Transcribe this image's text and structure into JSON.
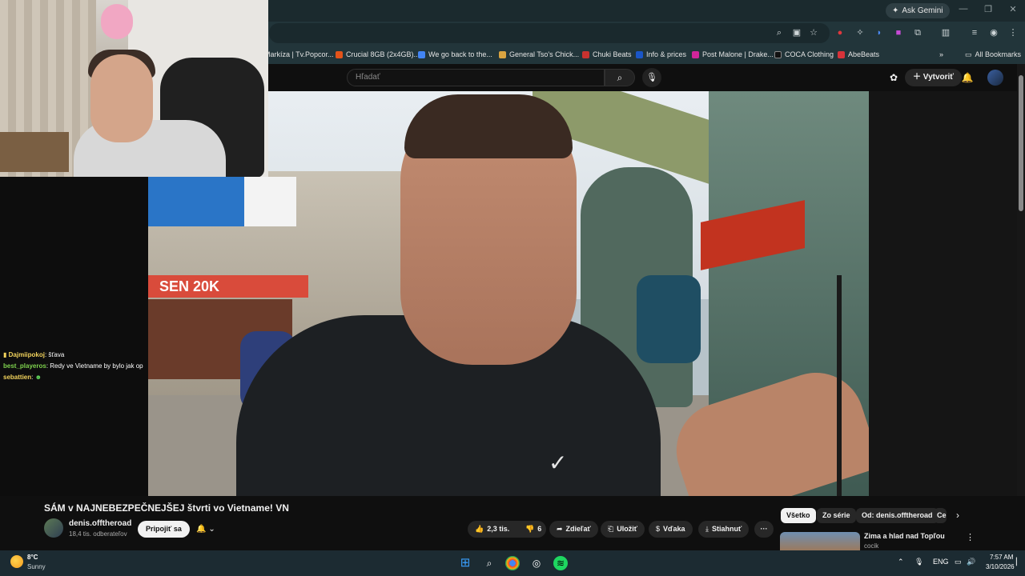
{
  "browser": {
    "ask_gemini": "Ask Gemini",
    "bookmarks": [
      {
        "label": "Markíza | Tv.Popcor...",
        "color": "#d9d9d9"
      },
      {
        "label": "Crucial 8GB (2x4GB)...",
        "color": "#e2531a"
      },
      {
        "label": "We go back to the...",
        "color": "#4285f4"
      },
      {
        "label": "General Tso's Chick...",
        "color": "#d9a441"
      },
      {
        "label": "Chuki Beats",
        "color": "#c8322f"
      },
      {
        "label": "Info & prices",
        "color": "#1a56c7"
      },
      {
        "label": "Post Malone | Drake...",
        "color": "#d0259a"
      },
      {
        "label": "COCA Clothing",
        "color": "#111111"
      },
      {
        "label": "AbeBeats",
        "color": "#d6333a"
      }
    ],
    "all_bookmarks": "All Bookmarks"
  },
  "youtube": {
    "search_placeholder": "Hľadať",
    "create_label": "Vytvoriť"
  },
  "chat": [
    {
      "user": "Dajmiipokoj",
      "user_color": "#f2d35c",
      "text": ": šťava"
    },
    {
      "user": "best_playeros",
      "user_color": "#7fd34e",
      "text": ": Redy ve Vietname by bylo jak op"
    },
    {
      "user": "sebattien",
      "user_color": "#f2d35c",
      "text": ":"
    }
  ],
  "video": {
    "sign_text": "SEN 20K"
  },
  "watch": {
    "title": "SÁM v NAJNEBEZPEČNEJŠEJ štvrti vo Vietname! VN",
    "channel_name": "denis.offtheroad",
    "subscribers": "18,4 tis. odberateľov",
    "join_label": "Pripojiť sa",
    "likes": "2,3 tis.",
    "dislikes": "6",
    "share_label": "Zdieľať",
    "save_label": "Uložiť",
    "thanks_label": "Vďaka",
    "download_label": "Stiahnuť"
  },
  "chips": [
    "Všetko",
    "Zo série",
    "Od: denis.offtheroad",
    "Ce"
  ],
  "recommendation": {
    "title": "Zima a hlad nad Topľou",
    "channel": "cocik"
  },
  "taskbar": {
    "temperature": "8°C",
    "condition": "Sunny",
    "language": "ENG",
    "time": "7:57 AM",
    "date": "3/10/2026"
  }
}
